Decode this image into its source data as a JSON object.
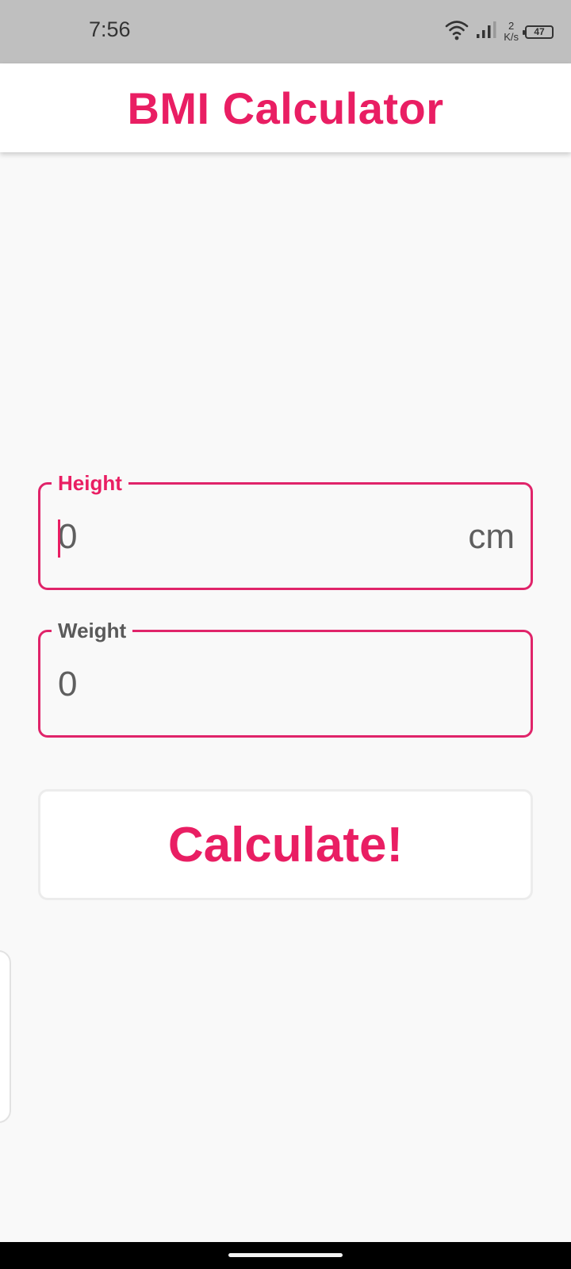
{
  "status_bar": {
    "time": "7:56",
    "net_speed_value": "2",
    "net_speed_unit": "K/s",
    "battery": "47",
    "icons": [
      "wifi-icon",
      "signal-icon",
      "battery-icon"
    ]
  },
  "app_bar": {
    "title": "BMI Calculator"
  },
  "form": {
    "height": {
      "label": "Height",
      "value": "0",
      "suffix": "cm",
      "focused": true
    },
    "weight": {
      "label": "Weight",
      "value": "0"
    },
    "calculate_label": "Calculate!"
  },
  "colors": {
    "accent": "#e91e63",
    "status_bar": "#bfbfbf",
    "background": "#f9f9f9",
    "text_secondary": "#5f5f5f"
  }
}
